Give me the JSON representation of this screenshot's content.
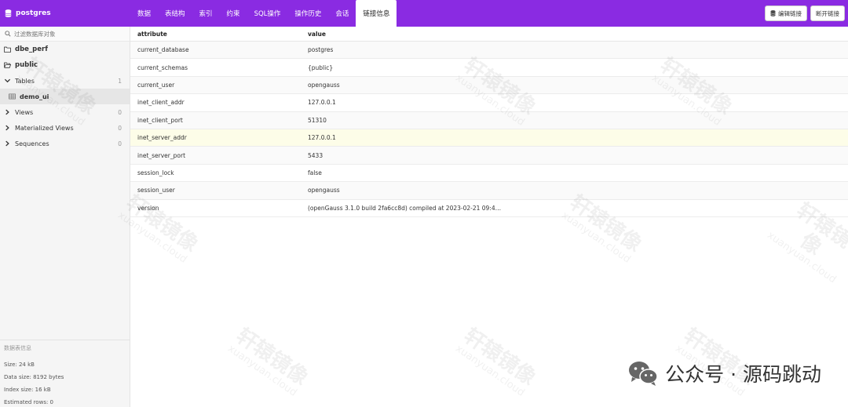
{
  "header": {
    "db_name": "postgres",
    "tabs": [
      {
        "label": "数据"
      },
      {
        "label": "表结构"
      },
      {
        "label": "索引"
      },
      {
        "label": "约束"
      },
      {
        "label": "SQL操作"
      },
      {
        "label": "操作历史"
      },
      {
        "label": "会话"
      },
      {
        "label": "链接信息"
      }
    ],
    "active_tab": "链接信息",
    "edit_button": "编辑链接",
    "disconnect_button": "断开链接"
  },
  "sidebar": {
    "filter_placeholder": "过滤数据库对象",
    "schemas": [
      "dbe_perf",
      "public"
    ],
    "groups": [
      {
        "label": "Tables",
        "count": "1",
        "expanded": true,
        "children": [
          "demo_ui"
        ]
      },
      {
        "label": "Views",
        "count": "0"
      },
      {
        "label": "Materialized Views",
        "count": "0"
      },
      {
        "label": "Sequences",
        "count": "0"
      }
    ],
    "info": {
      "title": "数据表信息",
      "size": "Size: 24 kB",
      "data_size": "Data size: 8192 bytes",
      "index_size": "Index size: 16 kB",
      "estimated_rows": "Estimated rows: 0"
    }
  },
  "table": {
    "columns": [
      "attribute",
      "value"
    ],
    "rows": [
      [
        "current_database",
        "postgres"
      ],
      [
        "current_schemas",
        "{public}"
      ],
      [
        "current_user",
        "opengauss"
      ],
      [
        "inet_client_addr",
        "127.0.0.1"
      ],
      [
        "inet_client_port",
        "51310"
      ],
      [
        "inet_server_addr",
        "127.0.0.1"
      ],
      [
        "inet_server_port",
        "5433"
      ],
      [
        "session_lock",
        "false"
      ],
      [
        "session_user",
        "opengauss"
      ],
      [
        "version",
        "(openGauss 3.1.0 build 2fa6cc8d) compiled at 2023-02-21 09:4…"
      ]
    ]
  },
  "watermark": {
    "main": "轩辕镜像",
    "sub": "xuanyuan.cloud"
  },
  "footer": {
    "text": "公众号 · 源码跳动"
  },
  "colors": {
    "accent": "#8a2be2",
    "highlight_row": "#fdfde8"
  }
}
